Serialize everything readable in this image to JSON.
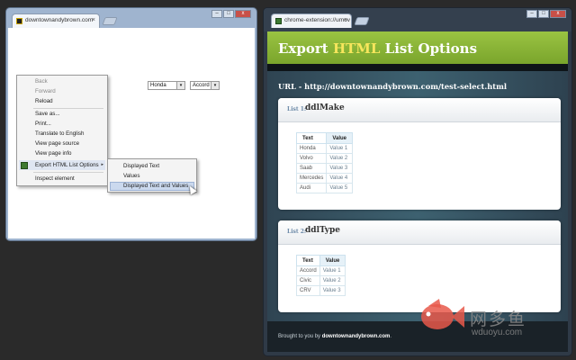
{
  "left_window": {
    "tab_title": "downtownandybrown.com",
    "tab_close": "×",
    "controls": {
      "minimize": "–",
      "maximize": "□",
      "close": "x"
    },
    "selects": [
      {
        "value": "Honda",
        "arrow": "▾"
      },
      {
        "value": "Accord",
        "arrow": "▾"
      }
    ],
    "context_menu": {
      "items": [
        "Back",
        "Forward",
        "Reload",
        "Save as...",
        "Print...",
        "Translate to English",
        "View page source",
        "View page info",
        "Export HTML List Options",
        "Inspect element"
      ],
      "disabled": [
        "Back",
        "Forward"
      ],
      "submenu_arrow": "▸"
    },
    "submenu": {
      "items": [
        "Displayed Text",
        "Values",
        "Displayed Text and Values"
      ]
    }
  },
  "right_window": {
    "tab_title": "chrome-extension://umov",
    "tab_close": "×",
    "controls": {
      "minimize": "–",
      "maximize": "□",
      "close": "x"
    },
    "header": {
      "title_pre": "Export ",
      "title_highlight": "HTML",
      "title_post": " List Options"
    },
    "url_line": "URL - http://downtownandybrown.com/test-select.html",
    "lists": [
      {
        "label": "List 1:",
        "name": "ddlMake",
        "columns": [
          "Text",
          "Value"
        ],
        "rows": [
          [
            "Honda",
            "Value 1"
          ],
          [
            "Volvo",
            "Value 2"
          ],
          [
            "Saab",
            "Value 3"
          ],
          [
            "Mercedes",
            "Value 4"
          ],
          [
            "Audi",
            "Value 5"
          ]
        ]
      },
      {
        "label": "List 2:",
        "name": "ddlType",
        "columns": [
          "Text",
          "Value"
        ],
        "rows": [
          [
            "Accord",
            "Value 1"
          ],
          [
            "Civic",
            "Value 2"
          ],
          [
            "CRV",
            "Value 3"
          ]
        ]
      }
    ],
    "footer": {
      "prefix": "Brought to you by ",
      "link": "downtownandybrown.com",
      "suffix": "."
    }
  },
  "watermark": {
    "cn": "网多鱼",
    "en": "wduoyu.com"
  },
  "colors": {
    "header_green": "#8bb838",
    "accent_yellow": "#f7e65c",
    "page_bg": "#2b3b47",
    "table_header_blue": "#e6f1f8"
  }
}
